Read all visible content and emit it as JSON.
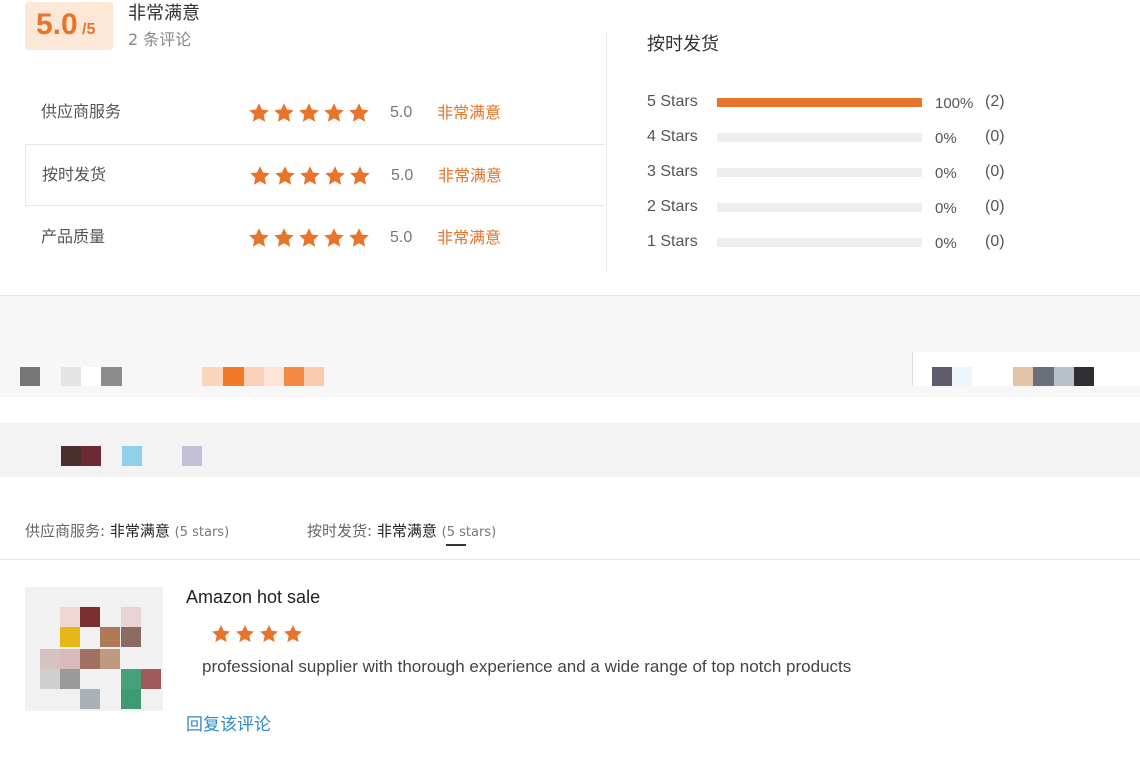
{
  "summary": {
    "score": "5.0",
    "score_max": "/5",
    "overall_label": "非常满意",
    "review_count": "2 条评论"
  },
  "categories": [
    {
      "name": "供应商服务",
      "score": "5.0",
      "label": "非常满意",
      "stars": 5
    },
    {
      "name": "按时发货",
      "score": "5.0",
      "label": "非常满意",
      "stars": 5
    },
    {
      "name": "产品质量",
      "score": "5.0",
      "label": "非常满意",
      "stars": 5
    }
  ],
  "distribution": {
    "title": "按时发货",
    "rows": [
      {
        "label": "5 Stars",
        "fraction": 1.0,
        "pct": "100%",
        "count": "(2)"
      },
      {
        "label": "4 Stars",
        "fraction": 0,
        "pct": "0%",
        "count": "(0)"
      },
      {
        "label": "3 Stars",
        "fraction": 0,
        "pct": "0%",
        "count": "(0)"
      },
      {
        "label": "2 Stars",
        "fraction": 0,
        "pct": "0%",
        "count": "(0)"
      },
      {
        "label": "1 Stars",
        "fraction": 0,
        "pct": "0%",
        "count": "(0)"
      }
    ]
  },
  "sub_ratings": [
    {
      "key": "供应商服务:",
      "value": "非常满意",
      "stars": "(5 stars)"
    },
    {
      "key": "按时发货:",
      "value": "非常满意",
      "stars": "(5 stars)"
    }
  ],
  "review": {
    "title": "Amazon hot sale",
    "stars": 4,
    "text": "professional supplier with thorough experience and a wide range of top notch products",
    "reply_label": "回复该评论"
  },
  "colors": {
    "accent": "#e8732a",
    "link": "#2f88c8",
    "bar_bg": "#eeeeee"
  },
  "icons": {
    "rating_star": "star-icon"
  }
}
